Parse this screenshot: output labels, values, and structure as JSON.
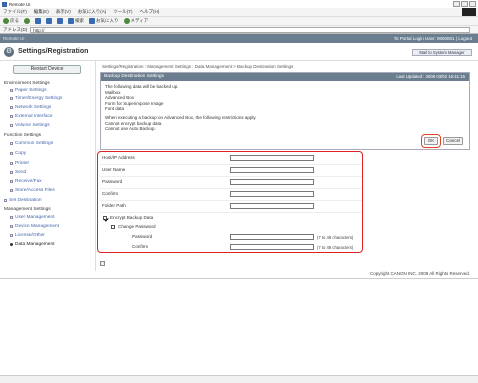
{
  "window": {
    "title": "Remote UI"
  },
  "menu": [
    "ファイル(F)",
    "編集(E)",
    "表示(V)",
    "お気に入り(A)",
    "ツール(T)",
    "ヘルプ(H)"
  ],
  "toolbar": {
    "back": "戻る",
    "search": "検索",
    "favorites": "お気に入り",
    "media": "メディア"
  },
  "address": {
    "label": "アドレス(D)",
    "url": "http://"
  },
  "app": {
    "brand": "Remote UI",
    "links": "To Portal   Login User: 0000001 | Logout",
    "page_title": "Settings/Registration",
    "status_button": "Mail to System Manager"
  },
  "sidebar": {
    "reset": "Restart Device",
    "sections": {
      "environment": "Environment Settings",
      "function": "Function Settings",
      "management": "Management Settings"
    },
    "environment_items": [
      "Paper Settings",
      "Timer/Energy Settings",
      "Network Settings",
      "External Interface",
      "Volume Settings"
    ],
    "function_items": [
      "Common Settings",
      "Copy",
      "Printer",
      "Send",
      "Receive/Fax",
      "Store/Access Files"
    ],
    "set_destination": "Set Destination",
    "management_items": [
      "User Management",
      "Device Management",
      "License/Other",
      "Data Management"
    ]
  },
  "breadcrumb": "Settings/Registration : Management Settings : Data Management > Backup Destination Settings",
  "panel": {
    "title": "Backup Destination Settings",
    "updated": "Last Updated : 2008 03/02 16:41:15",
    "lines": [
      "The following data will be backed up.",
      "Mailbox",
      "Advanced Box",
      "Form for Superimpose Image",
      "Font data",
      "",
      "When executing a backup on Advanced Box, the following restrictions apply.",
      "Cannot encrypt backup data.",
      "Cannot use Auto Backup."
    ],
    "ok": "OK",
    "cancel": "Cancel"
  },
  "form": {
    "host": "Host/IP Address",
    "user": "User Name",
    "password": "Password",
    "confirm": "Confirm",
    "folder": "Folder Path",
    "encrypt": "Encrypt Backup Data",
    "change": "Change Password",
    "enc_password": "Password",
    "enc_confirm": "Confirm",
    "hint": "(7 to 48 characters)"
  },
  "footer": {
    "copyright": "Copyright CANON INC. 2008 All Rights Reserved."
  }
}
